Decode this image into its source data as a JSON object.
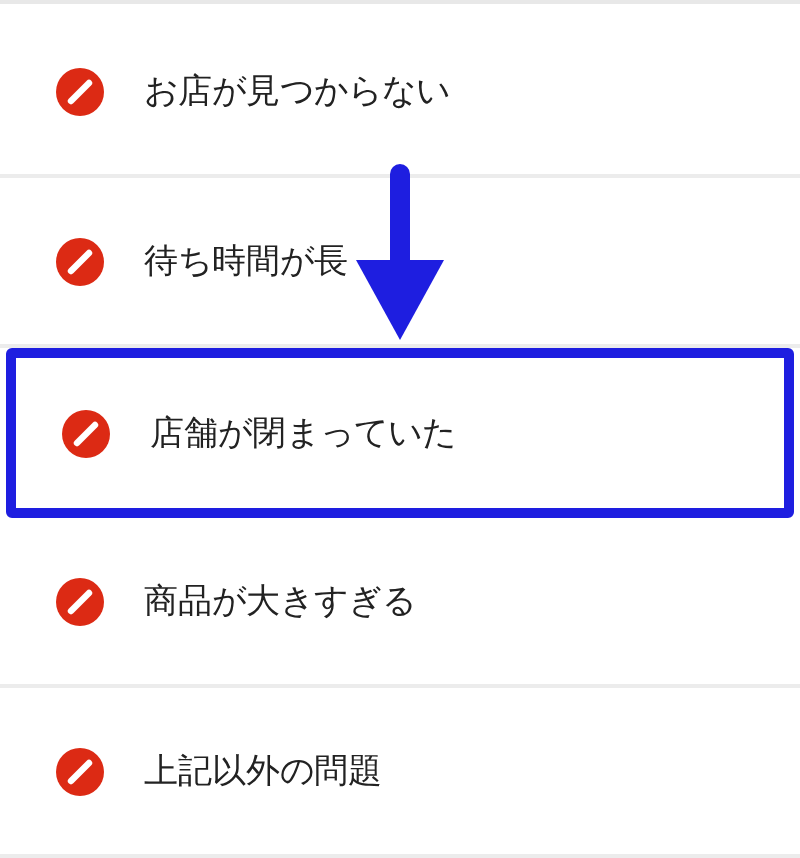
{
  "items": [
    {
      "label": "お店が見つからない",
      "selected": false
    },
    {
      "label": "待ち時間が長",
      "selected": false
    },
    {
      "label": "店舗が閉まっていた",
      "selected": true
    },
    {
      "label": "商品が大きすぎる",
      "selected": false
    },
    {
      "label": "上記以外の問題",
      "selected": false
    }
  ]
}
